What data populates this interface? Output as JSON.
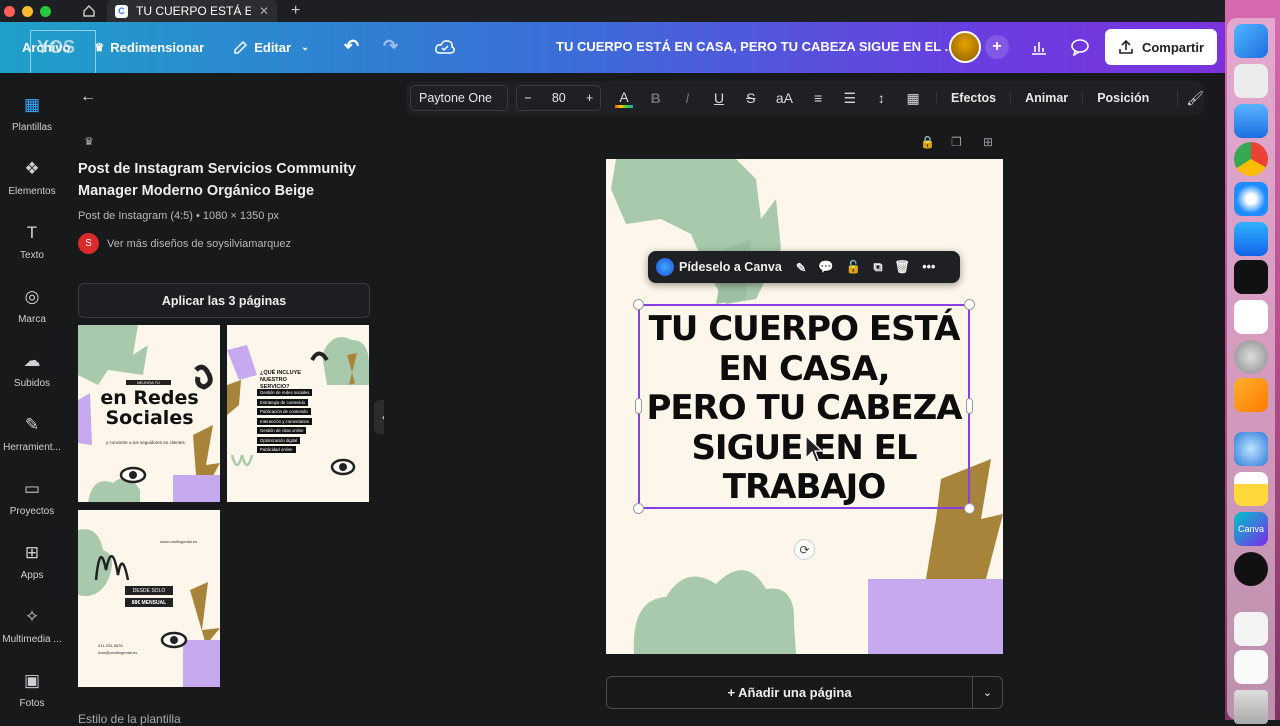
{
  "browser": {
    "tab_title": "TU CUERPO ESTÁ E...",
    "new_tab": "+"
  },
  "topbar": {
    "archivo": "Archivo",
    "redimensionar": "Redimensionar",
    "editar": "Editar",
    "doc_title": "TU CUERPO ESTÁ EN CASA, PERO TU CABEZA SIGUE EN EL ...",
    "share": "Compartir",
    "plus": "+"
  },
  "watermark": "YOS",
  "sidebar": {
    "items": [
      {
        "label": "Plantillas",
        "icon": "templates-icon"
      },
      {
        "label": "Elementos",
        "icon": "elements-icon"
      },
      {
        "label": "Texto",
        "icon": "text-icon"
      },
      {
        "label": "Marca",
        "icon": "brand-icon"
      },
      {
        "label": "Subidos",
        "icon": "uploads-icon"
      },
      {
        "label": "Herramient...",
        "icon": "tools-icon"
      },
      {
        "label": "Proyectos",
        "icon": "projects-icon"
      },
      {
        "label": "Apps",
        "icon": "apps-icon"
      },
      {
        "label": "Multimedia ...",
        "icon": "multimedia-icon"
      },
      {
        "label": "Fotos",
        "icon": "photos-icon"
      }
    ]
  },
  "panel": {
    "title": "Post de Instagram Servicios Community Manager Moderno Orgánico Beige",
    "meta": "Post de Instagram (4:5) • 1080 × 1350 px",
    "author_initial": "S",
    "author_link": "Ver más diseños de soysilviamarquez",
    "apply_button": "Aplicar las 3 páginas",
    "thumbs": [
      {
        "small": "MEJORA TU PRESENCIA",
        "big": "en Redes Sociales",
        "sub": "y convierte a tus seguidores en clientes"
      },
      {
        "heading": "¿QUÉ INCLUYE NUESTRO SERVICIO?",
        "items": [
          "Gestión de redes sociales",
          "Estrategia de contenido",
          "Publicación de contenido",
          "Interacción y comentarios",
          "Gestión de citas online",
          "Optimización digital",
          "Publicidad online"
        ]
      },
      {
        "url": "www.unsitiogenial.es",
        "price1": "DESDE SOLO",
        "price2": "88€ MENSUAL",
        "phone": "911-234-5678",
        "email": "hola@unsitiogenial.es"
      }
    ],
    "footer": "Estilo de la plantilla"
  },
  "toolbar": {
    "font": "Paytone One",
    "minus": "−",
    "size": "80",
    "plus": "+",
    "effects": "Efectos",
    "animate": "Animar",
    "position": "Posición"
  },
  "canvas": {
    "headline_lines": [
      "TU CUERPO ESTÁ",
      "EN CASA,",
      "PERO TU CABEZA",
      "SIGUE EN EL",
      "TRABAJO"
    ],
    "ctx_label": "Pídeselo a Canva",
    "add_page": "+ Añadir una página"
  },
  "colors": {
    "canvas_bg": "#fdf6ea",
    "selection": "#8b3fe0",
    "sage": "#a9c9ad",
    "lavender": "#c7a9f0",
    "ochre": "#a8843a"
  }
}
